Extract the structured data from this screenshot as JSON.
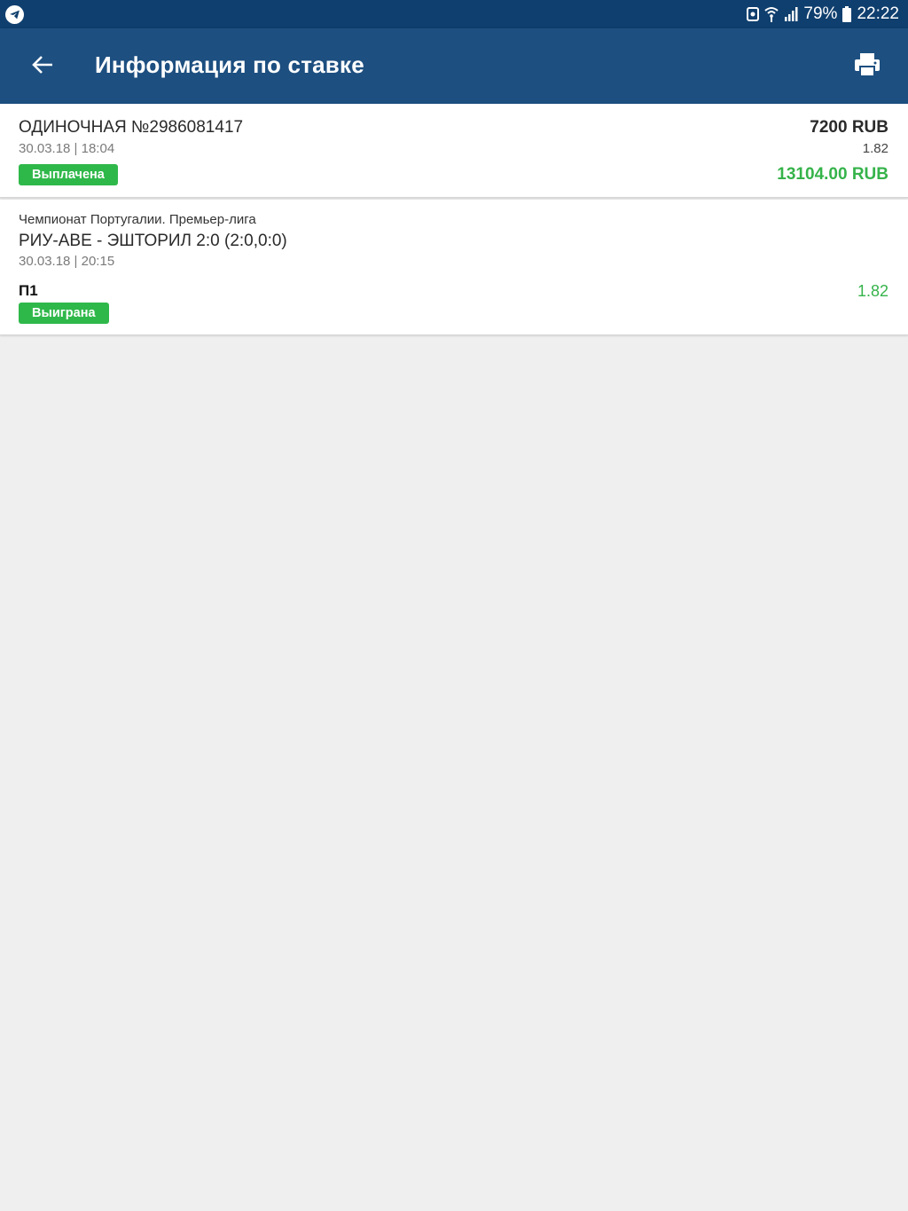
{
  "status_bar": {
    "battery_percent": "79%",
    "time": "22:22",
    "icons": [
      "telegram-icon",
      "nfc-icon",
      "wifi-icon",
      "signal-icon",
      "battery-icon"
    ]
  },
  "app_bar": {
    "title": "Информация по ставке",
    "back_icon": "arrow-left-icon",
    "print_icon": "print-icon"
  },
  "bet": {
    "type_number": "ОДИНОЧНАЯ №2986081417",
    "datetime": "30.03.18 | 18:04",
    "status": "Выплачена",
    "stake": "7200 RUB",
    "coefficient": "1.82",
    "payout": "13104.00 RUB"
  },
  "event": {
    "league": "Чемпионат Португалии. Премьер-лига",
    "match": "РИУ-АВЕ - ЭШТОРИЛ 2:0 (2:0,0:0)",
    "datetime": "30.03.18 | 20:15",
    "outcome": "П1",
    "status": "Выиграна",
    "coefficient": "1.82"
  },
  "colors": {
    "status_bar": "#0f3f6e",
    "app_bar": "#1d4f80",
    "accent_green": "#2fb84a",
    "background": "#efefef"
  }
}
